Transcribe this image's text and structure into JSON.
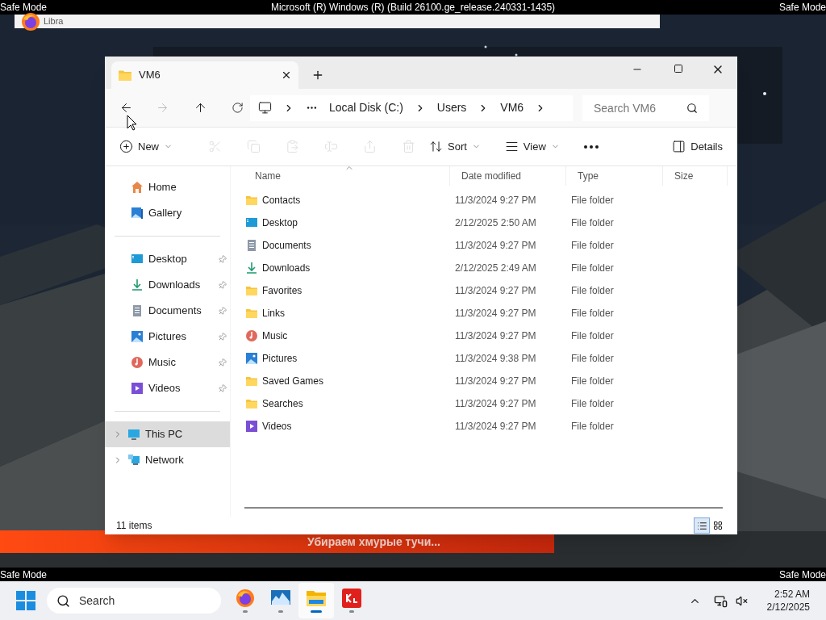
{
  "screen": {
    "corner_label_left": "Safe Mode",
    "corner_label_right": "Safe Mode",
    "title": "Microsoft (R) Windows (R) (Build 26100.ge_release.240331-1435)",
    "bottom_label_left": "Safe Mode",
    "bottom_label_right": "Safe Mode"
  },
  "background_window": {
    "title": "Libra"
  },
  "banner": {
    "text": "Убираем хмурые тучи..."
  },
  "explorer": {
    "tab": {
      "title": "VM6",
      "selected": true
    },
    "breadcrumbs": [
      "Local Disk (C:)",
      "Users",
      "VM6"
    ],
    "search": {
      "placeholder": "Search VM6"
    },
    "toolbar": [
      {
        "kind": "new",
        "label": "New",
        "disabled": false
      },
      {
        "kind": "cut",
        "disabled": true
      },
      {
        "kind": "copy",
        "disabled": true
      },
      {
        "kind": "paste",
        "disabled": true
      },
      {
        "kind": "rename",
        "disabled": true
      },
      {
        "kind": "share",
        "disabled": true
      },
      {
        "kind": "delete",
        "disabled": true
      },
      {
        "kind": "sort",
        "label": "Sort",
        "disabled": false
      },
      {
        "kind": "view",
        "label": "View",
        "disabled": false
      },
      {
        "kind": "more",
        "disabled": false
      }
    ],
    "details_button": "Details",
    "sidebar": {
      "quick": [
        {
          "label": "Home",
          "kind": "home"
        },
        {
          "label": "Gallery",
          "kind": "gallery"
        }
      ],
      "pinned": [
        {
          "label": "Desktop",
          "kind": "desktop",
          "pinned": true
        },
        {
          "label": "Downloads",
          "kind": "downloads",
          "pinned": true
        },
        {
          "label": "Documents",
          "kind": "documents",
          "pinned": true
        },
        {
          "label": "Pictures",
          "kind": "pictures",
          "pinned": true
        },
        {
          "label": "Music",
          "kind": "music",
          "pinned": true
        },
        {
          "label": "Videos",
          "kind": "videos",
          "pinned": true
        }
      ],
      "locations": [
        {
          "label": "This PC",
          "kind": "pc",
          "selected": true
        },
        {
          "label": "Network",
          "kind": "network",
          "selected": false
        }
      ]
    },
    "columns": [
      "Name",
      "Date modified",
      "Type",
      "Size"
    ],
    "rows": [
      {
        "name": "Contacts",
        "kind": "folder",
        "date": "11/3/2024 9:27 PM",
        "type": "File folder"
      },
      {
        "name": "Desktop",
        "kind": "desktop",
        "date": "2/12/2025 2:50 AM",
        "type": "File folder"
      },
      {
        "name": "Documents",
        "kind": "documents",
        "date": "11/3/2024 9:27 PM",
        "type": "File folder"
      },
      {
        "name": "Downloads",
        "kind": "downloads",
        "date": "2/12/2025 2:49 AM",
        "type": "File folder"
      },
      {
        "name": "Favorites",
        "kind": "folder",
        "date": "11/3/2024 9:27 PM",
        "type": "File folder"
      },
      {
        "name": "Links",
        "kind": "folder",
        "date": "11/3/2024 9:27 PM",
        "type": "File folder"
      },
      {
        "name": "Music",
        "kind": "music",
        "date": "11/3/2024 9:27 PM",
        "type": "File folder"
      },
      {
        "name": "Pictures",
        "kind": "pictures",
        "date": "11/3/2024 9:38 PM",
        "type": "File folder"
      },
      {
        "name": "Saved Games",
        "kind": "folder",
        "date": "11/3/2024 9:27 PM",
        "type": "File folder"
      },
      {
        "name": "Searches",
        "kind": "folder",
        "date": "11/3/2024 9:27 PM",
        "type": "File folder"
      },
      {
        "name": "Videos",
        "kind": "videos",
        "date": "11/3/2024 9:27 PM",
        "type": "File folder"
      }
    ],
    "status": "11 items",
    "view_modes": [
      {
        "kind": "details",
        "selected": true
      },
      {
        "kind": "tiles",
        "selected": false
      }
    ]
  },
  "taskbar": {
    "search": {
      "placeholder": "Search"
    },
    "apps": [
      {
        "kind": "firefox",
        "selected": false
      },
      {
        "kind": "monitor",
        "selected": false
      },
      {
        "kind": "explorer",
        "selected": true
      },
      {
        "kind": "red-app",
        "selected": false
      }
    ],
    "time": "2:52 AM",
    "date": "2/12/2025"
  }
}
